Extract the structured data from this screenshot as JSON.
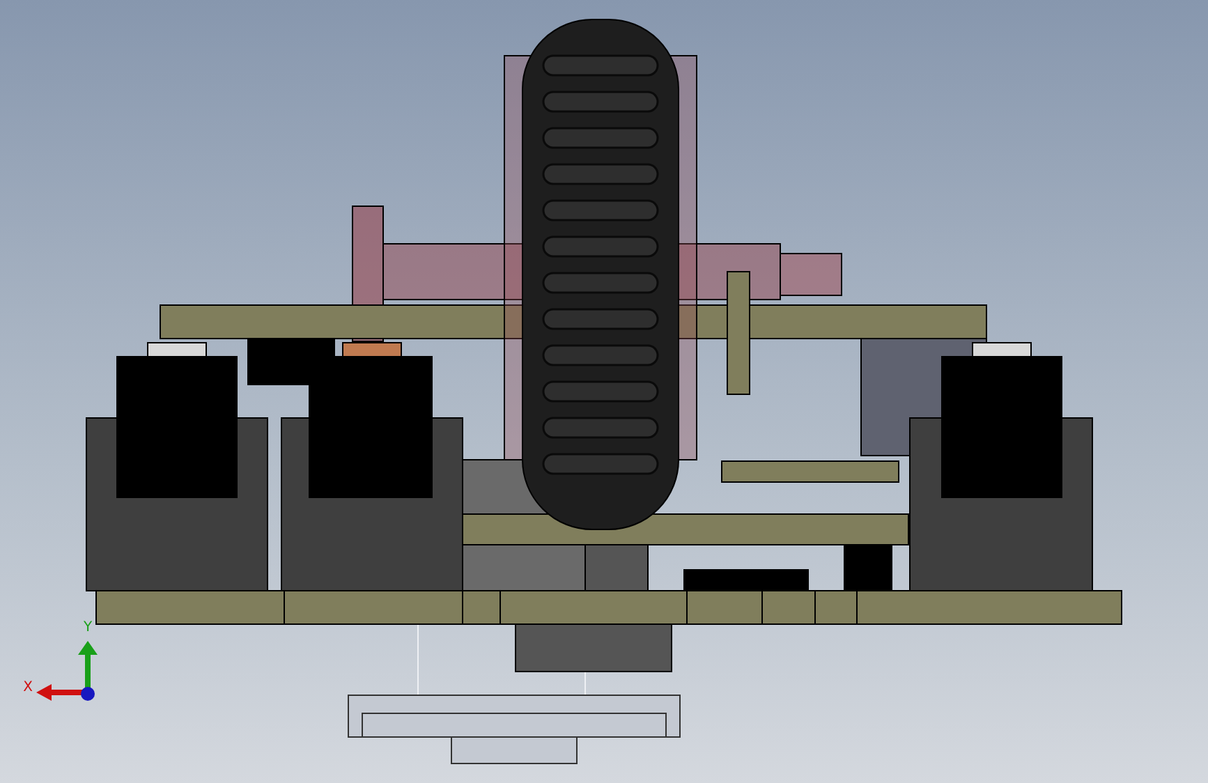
{
  "viewport": {
    "triad": {
      "axes": [
        {
          "label": "Y",
          "color": "#19a019"
        },
        {
          "label": "X",
          "color": "#d01010"
        }
      ]
    }
  }
}
